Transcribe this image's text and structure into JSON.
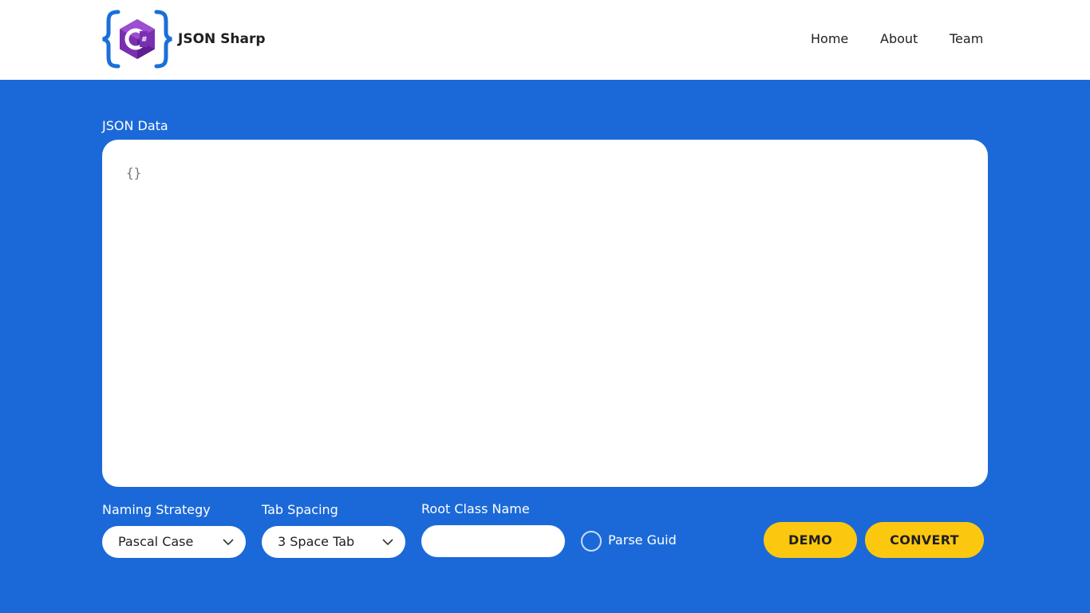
{
  "header": {
    "brand": "JSON Sharp",
    "logo_icon": "csharp-braces-logo",
    "nav": [
      {
        "label": "Home"
      },
      {
        "label": "About"
      },
      {
        "label": "Team"
      }
    ]
  },
  "editor": {
    "label": "JSON Data",
    "content": "{}"
  },
  "options": {
    "naming_strategy": {
      "label": "Naming Strategy",
      "selected": "Pascal Case"
    },
    "tab_spacing": {
      "label": "Tab Spacing",
      "selected": "3 Space Tab"
    },
    "root_class_name": {
      "label": "Root Class Name",
      "value": "",
      "placeholder": ""
    },
    "parse_guid": {
      "label": "Parse Guid",
      "checked": false
    }
  },
  "actions": {
    "demo_label": "DEMO",
    "convert_label": "CONVERT"
  },
  "colors": {
    "background": "#1b69d8",
    "accent_button": "#fcc80f",
    "header_bg": "#ffffff"
  }
}
